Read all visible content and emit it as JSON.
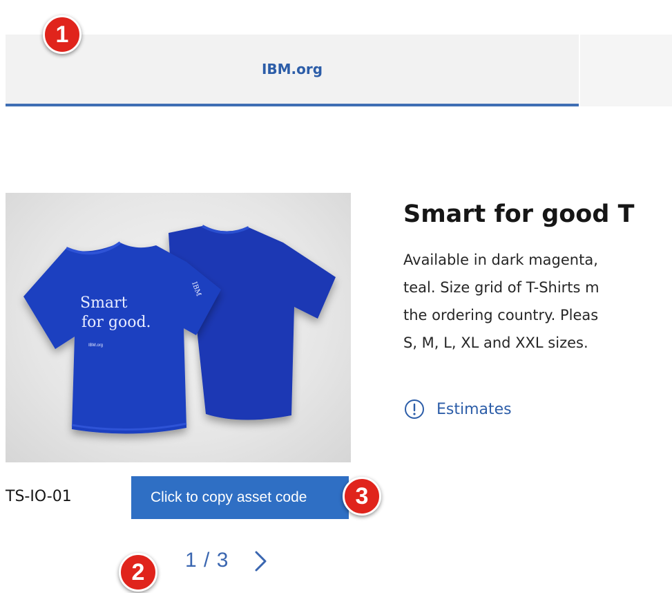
{
  "tabs": [
    {
      "label": "IBM.org",
      "active": true
    },
    {
      "label": "",
      "active": false
    }
  ],
  "callouts": [
    "1",
    "2",
    "3"
  ],
  "product": {
    "shirt_print_line1": "Smart",
    "shirt_print_line2": "for good.",
    "shirt_print_small": "IBM.org",
    "sleeve_print": "IBM",
    "asset_code": "TS-IO-01",
    "copy_button_label": "Click to copy asset code",
    "pager": "1 / 3",
    "title": "Smart for good T",
    "description_lines": [
      "Available in dark magenta,",
      "teal. Size grid of T-Shirts m",
      "the ordering country. Pleas",
      "S, M, L, XL and XXL sizes."
    ],
    "estimates_label": "Estimates"
  },
  "colors": {
    "accent_blue": "#3f6eb4",
    "button_blue": "#2f6fc4",
    "callout_red": "#e0241c",
    "shirt_blue": "#1d3fc0"
  },
  "icons": {
    "pager_next": "chevron-right-icon",
    "estimates": "info-circle-icon"
  }
}
